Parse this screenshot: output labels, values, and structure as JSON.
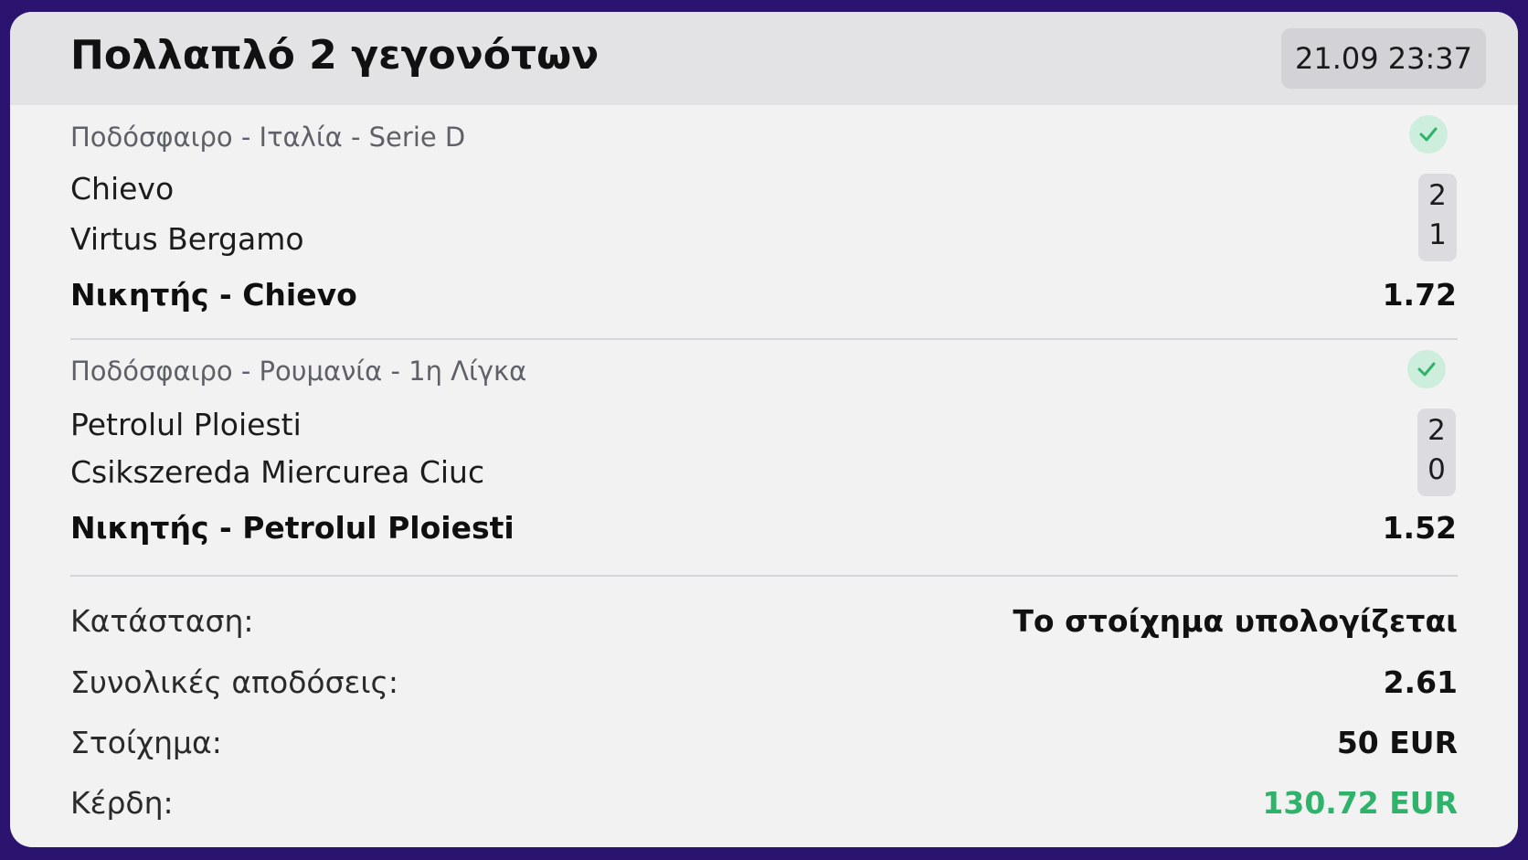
{
  "header": {
    "title": "Πολλαπλό 2 γεγονότων",
    "datetime": "21.09 23:37"
  },
  "events": [
    {
      "sport": "Ποδόσφαιρο - Ιταλία - Serie D",
      "home_team": "Chievo",
      "away_team": "Virtus Bergamo",
      "home_score": "2",
      "away_score": "1",
      "pick": "Νικητής - Chievo",
      "odds": "1.72",
      "status_icon": "check-icon"
    },
    {
      "sport": "Ποδόσφαιρο - Ρουμανία - 1η Λίγκα",
      "home_team": "Petrolul Ploiesti",
      "away_team": "Csikszereda Miercurea Ciuc",
      "home_score": "2",
      "away_score": "0",
      "pick": "Νικητής - Petrolul Ploiesti",
      "odds": "1.52",
      "status_icon": "check-icon"
    }
  ],
  "summary": {
    "status_label": "Κατάσταση:",
    "status_value": "Το στοίχημα υπολογίζεται",
    "total_odds_label": "Συνολικές αποδόσεις:",
    "total_odds_value": "2.61",
    "stake_label": "Στοίχημα:",
    "stake_value": "50 EUR",
    "winnings_label": "Κέρδη:",
    "winnings_value": "130.72 EUR"
  },
  "colors": {
    "background": "#2a1470",
    "card": "#f2f2f3",
    "header": "#e3e3e6",
    "win_green": "#2fb36b",
    "check_bg": "#cdeedc"
  }
}
